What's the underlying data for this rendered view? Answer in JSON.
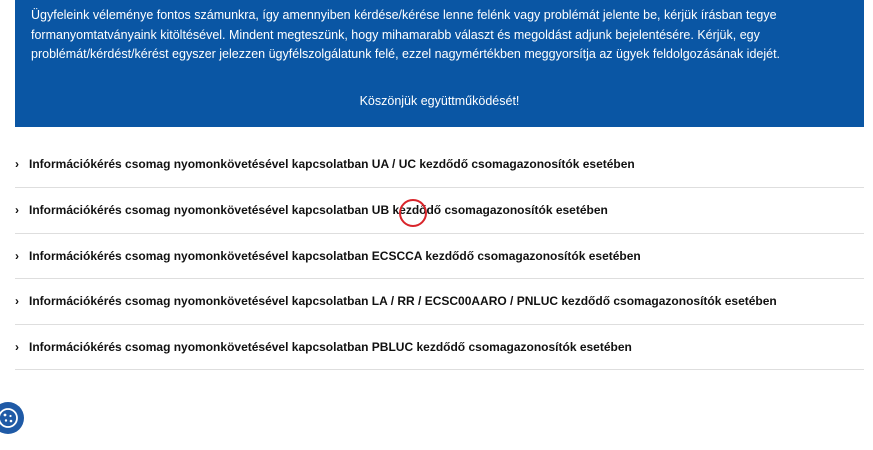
{
  "notice": {
    "paragraph": "Ügyfeleink véleménye fontos számunkra, így amennyiben kérdése/kérése lenne felénk vagy problémát jelente be, kérjük írásban tegye formanyomtatványaink kitöltésével. Mindent megteszünk, hogy mihamarabb választ és megoldást adjunk bejelentésére. Kérjük, egy problémát/kérdést/kérést egyszer jelezzen ügyfélszolgálatunk felé, ezzel nagymértékben meggyorsítja az ügyek feldolgozásának idejét.",
    "thanks": "Köszönjük együttműködését!"
  },
  "accordion": {
    "items": [
      {
        "label": "Információkérés csomag nyomonkövetésével kapcsolatban UA / UC kezdődő csomagazonosítók esetében"
      },
      {
        "label": "Információkérés csomag nyomonkövetésével kapcsolatban UB kezdődő csomagazonosítók esetében"
      },
      {
        "label": "Információkérés csomag nyomonkövetésével kapcsolatban ECSCCA kezdődő csomagazonosítók esetében"
      },
      {
        "label": "Információkérés csomag nyomonkövetésével kapcsolatban LA / RR / ECSC00AARO / PNLUC kezdődő csomagazonosítók esetében"
      },
      {
        "label": "Információkérés csomag nyomonkövetésével kapcsolatban PBLUC kezdődő csomagazonosítók esetében"
      }
    ],
    "chevron": "›"
  },
  "colors": {
    "notice_bg": "#0a56a4",
    "highlight_ring": "#d9252b",
    "cookie_button": "#1f5aa6"
  },
  "icons": {
    "cookie_button": "cookie-icon",
    "chevron": "chevron-right-icon"
  }
}
